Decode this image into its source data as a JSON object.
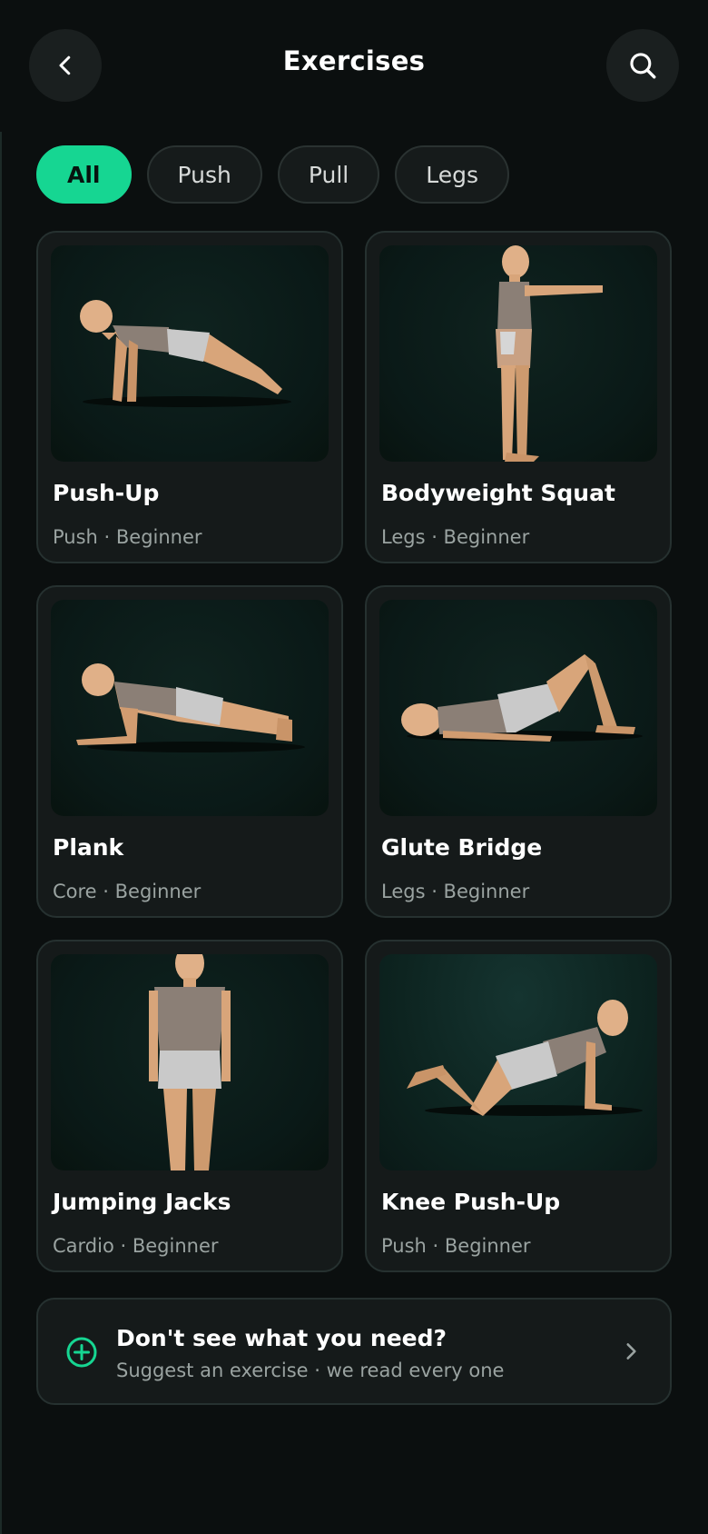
{
  "header": {
    "title": "Exercises",
    "back_icon": "chevron-left-icon",
    "search_icon": "search-icon"
  },
  "filters": [
    {
      "label": "All",
      "active": true
    },
    {
      "label": "Push",
      "active": false
    },
    {
      "label": "Pull",
      "active": false
    },
    {
      "label": "Legs",
      "active": false
    }
  ],
  "exercises": [
    {
      "name": "Push-Up",
      "meta": "Push · Beginner",
      "pose": "push-up-figure"
    },
    {
      "name": "Bodyweight Squat",
      "meta": "Legs · Beginner",
      "pose": "squat-figure"
    },
    {
      "name": "Plank",
      "meta": "Core · Beginner",
      "pose": "plank-figure"
    },
    {
      "name": "Glute Bridge",
      "meta": "Legs · Beginner",
      "pose": "glute-bridge-figure"
    },
    {
      "name": "Jumping Jacks",
      "meta": "Cardio · Beginner",
      "pose": "standing-figure"
    },
    {
      "name": "Knee Push-Up",
      "meta": "Push · Beginner",
      "pose": "knee-push-up-figure"
    }
  ],
  "suggest": {
    "title": "Don't see what you need?",
    "subtitle": "Suggest an exercise · we read every one",
    "icon": "plus-circle-icon",
    "chevron": "chevron-right-icon"
  },
  "colors": {
    "accent": "#16d692",
    "background": "#0b0f0f",
    "card": "#151a1a"
  }
}
